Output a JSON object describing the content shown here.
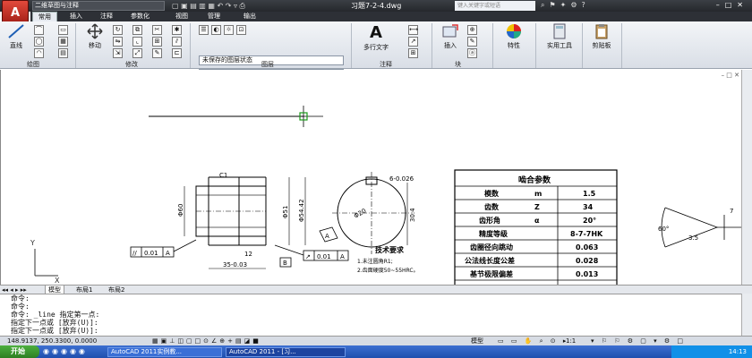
{
  "app": {
    "workspace": "二维草图与注释",
    "doc_title": "习题7-2-4.dwg",
    "search_placeholder": "键入关键字或短语"
  },
  "ribbon_tabs": [
    "常用",
    "插入",
    "注释",
    "参数化",
    "视图",
    "管理",
    "输出"
  ],
  "ribbon": {
    "draw_line": "直线",
    "modify_move": "移动",
    "layer_state": "未保存的图层状态",
    "layer_current": "0",
    "multiline_text": "多行文字",
    "insert": "插入",
    "properties": "特性",
    "utilities": "实用工具",
    "clipboard": "剪贴板",
    "panels": [
      "绘图",
      "修改",
      "图层",
      "注释",
      "块"
    ]
  },
  "drawing": {
    "table_title": "啮合参数",
    "table_rows": [
      {
        "param": "模数",
        "sym": "m",
        "val": "1.5"
      },
      {
        "param": "齿数",
        "sym": "Z",
        "val": "34"
      },
      {
        "param": "齿形角",
        "sym": "α",
        "val": "20°"
      },
      {
        "param": "精度等级",
        "sym": "",
        "val": "8-7-7HK"
      },
      {
        "param": "齿圈径向跳动",
        "sym": "",
        "val": "0.063"
      },
      {
        "param": "公法线长度公差",
        "sym": "",
        "val": "0.028"
      },
      {
        "param": "基节极限偏差",
        "sym": "",
        "val": "0.013"
      }
    ],
    "tech_title": "技术要求",
    "tech_items": [
      "1.未注圆角R1;",
      "2.齿面硬度50~55HRC。"
    ],
    "labels": {
      "c1": "C1",
      "d60": "Φ60",
      "d51": "Φ51",
      "d5442": "Φ54.42",
      "len35": "35-0.03",
      "len12": "12",
      "flat": "0.01",
      "flat_ref": "A",
      "runout": "0.01",
      "runout_ref": "A",
      "datum_b": "B",
      "datum_a": "A",
      "key_dim": "6-0.026",
      "bore": "Φ20",
      "depth": "30.4",
      "angle": "60°",
      "dim35b": "3.5",
      "dim7": "7"
    }
  },
  "layout_tabs": [
    "模型",
    "布局1",
    "布局2"
  ],
  "command_lines": [
    "命令:",
    "命令:",
    "命令: _line 指定第一点:",
    "指定下一点或 [放弃(U)]:",
    "指定下一点或 [放弃(U)]:"
  ],
  "status": {
    "coords": "148.9137, 250.3300, 0.0000",
    "model": "模型",
    "scale": "1:1"
  },
  "taskbar": {
    "start": "开始",
    "tasks": [
      "AutoCAD 2011实例教...",
      "AutoCAD 2011 - [习..."
    ],
    "clock": "14:13"
  }
}
